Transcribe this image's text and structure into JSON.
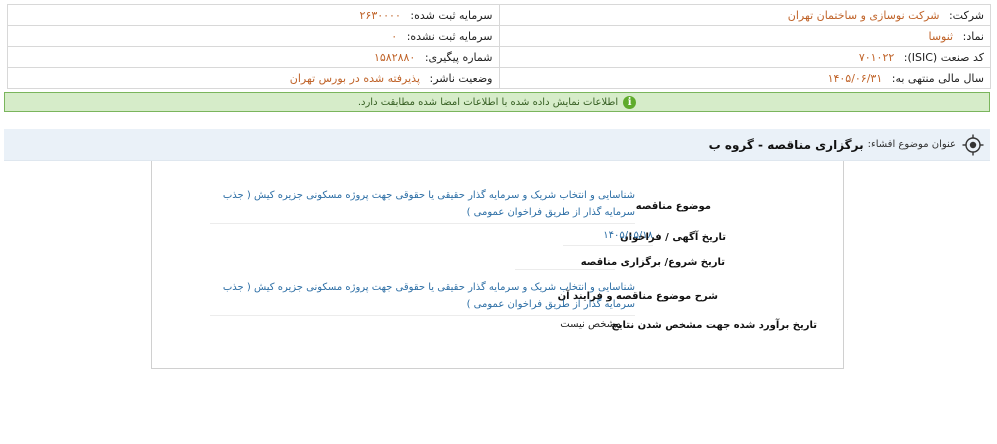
{
  "company": {
    "company_label": "شرکت:",
    "company_value": "شرکت نوسازی و ساختمان تهران",
    "symbol_label": "نماد:",
    "symbol_value": "ثنوسا",
    "isic_label": "کد صنعت (ISIC):",
    "isic_value": "۷۰۱۰۲۲",
    "fiscal_label": "سال مالی منتهی به:",
    "fiscal_value": "۱۴۰۵/۰۶/۳۱",
    "reg_capital_label": "سرمایه ثبت شده:",
    "reg_capital_value": "۲۶۳۰۰۰۰",
    "unreg_capital_label": "سرمایه ثبت نشده:",
    "unreg_capital_value": "۰",
    "tracking_label": "شماره پیگیری:",
    "tracking_value": "۱۵۸۲۸۸۰",
    "publisher_label": "وضعیت ناشر:",
    "publisher_value": "پذیرفته شده در بورس تهران"
  },
  "notice": {
    "icon": "info-icon",
    "text": "اطلاعات نمایش داده شده با اطلاعات امضا شده مطابقت دارد."
  },
  "disclosure": {
    "subject_label": "عنوان موضوع افشاء:",
    "subject_value": "برگزاری مناقصه - گروه ب",
    "fields": [
      {
        "label": "موضوع مناقصه",
        "value": "شناسایی و انتخاب شریک و سرمایه گذار حقیقی یا حقوقی جهت پروژه مسکونی جزیره کیش ( جذب سرمایه گذار از طریق فراخوان عمومی )"
      },
      {
        "label": "تاریخ آگهی / فراخوان",
        "value": "۱۴۰۵/۰۵/۱۸"
      },
      {
        "label": "تاریخ شروع/ برگزاری مناقصه",
        "value": ""
      },
      {
        "label": "شرح موضوع مناقصه و فرایند آن",
        "value": "شناسایی و انتخاب شریک و سرمایه گذار حقیقی یا حقوقی جهت پروژه مسکونی جزیره کیش ( جذب سرمایه گذار از طریق فراخوان عمومی )"
      },
      {
        "label": "تاریخ برآورد شده جهت مشخص شدن نتایج",
        "value": "مشخص نیست"
      }
    ]
  }
}
